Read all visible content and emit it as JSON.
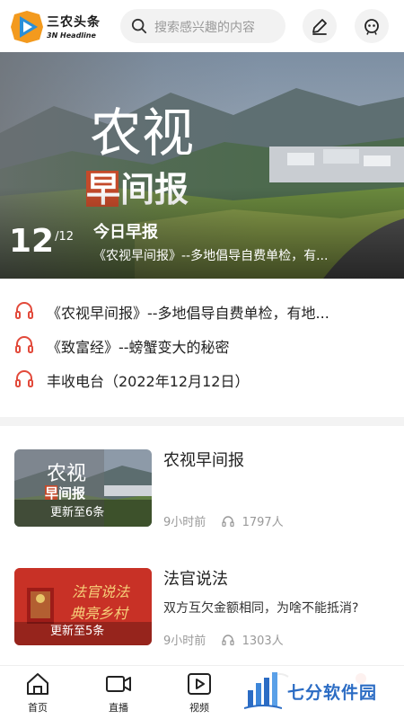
{
  "header": {
    "brand_cn": "三农头条",
    "brand_en": "3N Headline",
    "search_placeholder": "搜索感兴趣的内容"
  },
  "banner": {
    "current": "12",
    "total": "/12",
    "title": "今日早报",
    "subtitle": "《农视早间报》--多地倡导自费单检，有..."
  },
  "audio_list": [
    {
      "text": "《农视早间报》--多地倡导自费单检，有地..."
    },
    {
      "text": "《致富经》--螃蟹变大的秘密"
    },
    {
      "text": "丰收电台（2022年12月12日）"
    }
  ],
  "cards": [
    {
      "title": "农视早间报",
      "description": "",
      "update": "更新至6条",
      "time": "9小时前",
      "listeners": "1797人"
    },
    {
      "title": "法官说法",
      "description": "双方互欠金额相同，为啥不能抵消?",
      "update": "更新至5条",
      "time": "9小时前",
      "listeners": "1303人"
    }
  ],
  "nav": [
    {
      "label": "首页",
      "icon": "home-icon"
    },
    {
      "label": "直播",
      "icon": "video-camera-icon"
    },
    {
      "label": "视频",
      "icon": "play-icon"
    },
    {
      "label": "",
      "icon": "partial-icon"
    },
    {
      "label": "",
      "icon": "partial-icon"
    }
  ],
  "watermark": {
    "text": "七分软件园"
  },
  "colors": {
    "accent": "#e24a3b",
    "logo_blue": "#2a8fd8",
    "logo_orange": "#f39a1e"
  }
}
